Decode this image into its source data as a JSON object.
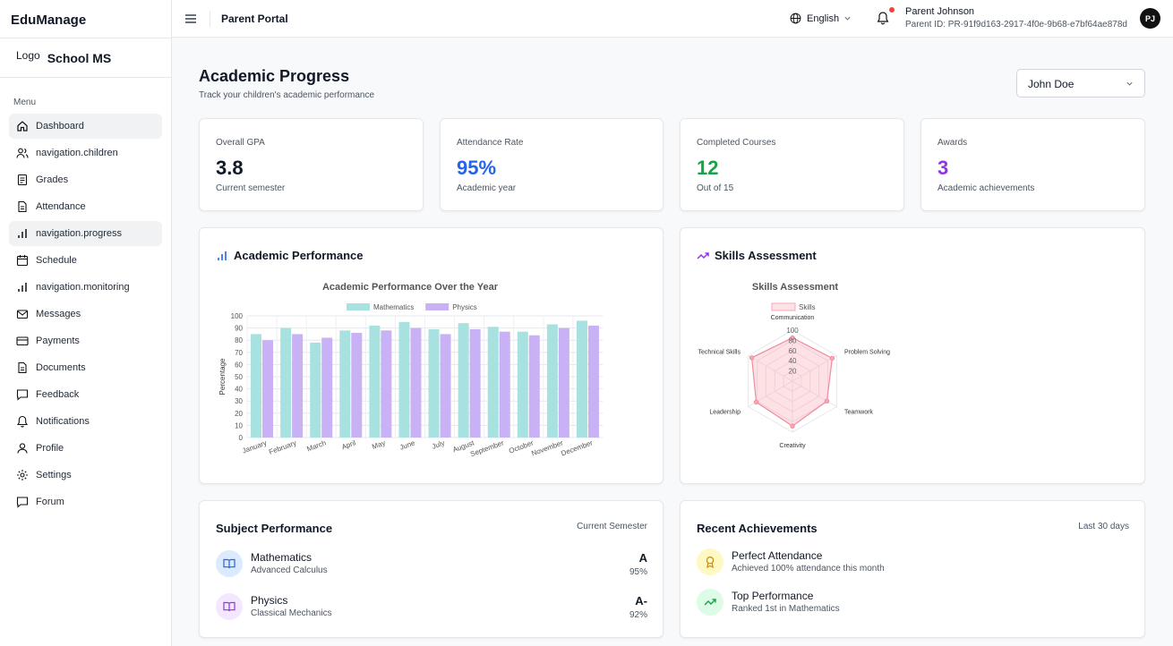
{
  "brand": "EduManage",
  "logo": {
    "logo_text": "Logo",
    "school_name": "School MS"
  },
  "menu_label": "Menu",
  "nav": [
    {
      "label": "Dashboard",
      "icon": "home-icon",
      "active": true
    },
    {
      "label": "navigation.children",
      "icon": "users-icon"
    },
    {
      "label": "Grades",
      "icon": "file-icon"
    },
    {
      "label": "Attendance",
      "icon": "document-icon"
    },
    {
      "label": "navigation.progress",
      "icon": "bar-chart-icon",
      "active": true
    },
    {
      "label": "Schedule",
      "icon": "calendar-icon"
    },
    {
      "label": "navigation.monitoring",
      "icon": "bar-chart-icon"
    },
    {
      "label": "Messages",
      "icon": "mail-icon"
    },
    {
      "label": "Payments",
      "icon": "credit-card-icon"
    },
    {
      "label": "Documents",
      "icon": "document-icon"
    },
    {
      "label": "Feedback",
      "icon": "message-icon"
    },
    {
      "label": "Notifications",
      "icon": "bell-icon"
    },
    {
      "label": "Profile",
      "icon": "user-icon"
    },
    {
      "label": "Settings",
      "icon": "gear-icon"
    },
    {
      "label": "Forum",
      "icon": "message-icon"
    }
  ],
  "topbar": {
    "title": "Parent Portal",
    "language": "English",
    "parent_name": "Parent Johnson",
    "parent_id": "Parent ID: PR-91f9d163-2917-4f0e-9b68-e7bf64ae878d",
    "avatar_initials": "PJ"
  },
  "page": {
    "title": "Academic Progress",
    "subtitle": "Track your children's academic performance",
    "child_select": "John Doe"
  },
  "stats": [
    {
      "label": "Overall GPA",
      "value": "3.8",
      "sub": "Current semester",
      "color": "#111827"
    },
    {
      "label": "Attendance Rate",
      "value": "95%",
      "sub": "Academic year",
      "color": "#2563eb"
    },
    {
      "label": "Completed Courses",
      "value": "12",
      "sub": "Out of 15",
      "color": "#16a34a"
    },
    {
      "label": "Awards",
      "value": "3",
      "sub": "Academic achievements",
      "color": "#9333ea"
    }
  ],
  "performance_card": {
    "title": "Academic Performance"
  },
  "skills_card": {
    "title": "Skills Assessment"
  },
  "chart_data": [
    {
      "type": "bar",
      "title": "Academic Performance Over the Year",
      "ylabel": "Percentage",
      "xlabel": "",
      "ylim": [
        0,
        100
      ],
      "yticks": [
        0,
        10,
        20,
        30,
        40,
        50,
        60,
        70,
        80,
        90,
        100
      ],
      "legend": "top",
      "grid": true,
      "categories": [
        "January",
        "February",
        "March",
        "April",
        "May",
        "June",
        "July",
        "August",
        "September",
        "October",
        "November",
        "December"
      ],
      "series": [
        {
          "name": "Mathematics",
          "color": "#a8e2e0",
          "values": [
            85,
            90,
            78,
            88,
            92,
            95,
            89,
            94,
            91,
            87,
            93,
            96
          ]
        },
        {
          "name": "Physics",
          "color": "#c8b1f4",
          "values": [
            80,
            85,
            82,
            86,
            88,
            90,
            85,
            89,
            87,
            84,
            90,
            92
          ]
        }
      ]
    },
    {
      "type": "radar",
      "title": "Skills Assessment",
      "legend": "top",
      "rticks": [
        20,
        40,
        60,
        80,
        100
      ],
      "rlim": [
        0,
        100
      ],
      "categories": [
        "Communication",
        "Problem Solving",
        "Teamwork",
        "Creativity",
        "Leadership",
        "Technical Skills"
      ],
      "series": [
        {
          "name": "Skills",
          "color": "#f9a8b4",
          "values": [
            85,
            90,
            78,
            88,
            82,
            92
          ]
        }
      ]
    }
  ],
  "subjects": {
    "title": "Subject Performance",
    "period": "Current Semester",
    "items": [
      {
        "name": "Mathematics",
        "detail": "Advanced Calculus",
        "grade": "A",
        "percent": "95%"
      },
      {
        "name": "Physics",
        "detail": "Classical Mechanics",
        "grade": "A-",
        "percent": "92%"
      }
    ]
  },
  "achievements": {
    "title": "Recent Achievements",
    "period": "Last 30 days",
    "items": [
      {
        "name": "Perfect Attendance",
        "detail": "Achieved 100% attendance this month"
      },
      {
        "name": "Top Performance",
        "detail": "Ranked 1st in Mathematics"
      }
    ]
  }
}
